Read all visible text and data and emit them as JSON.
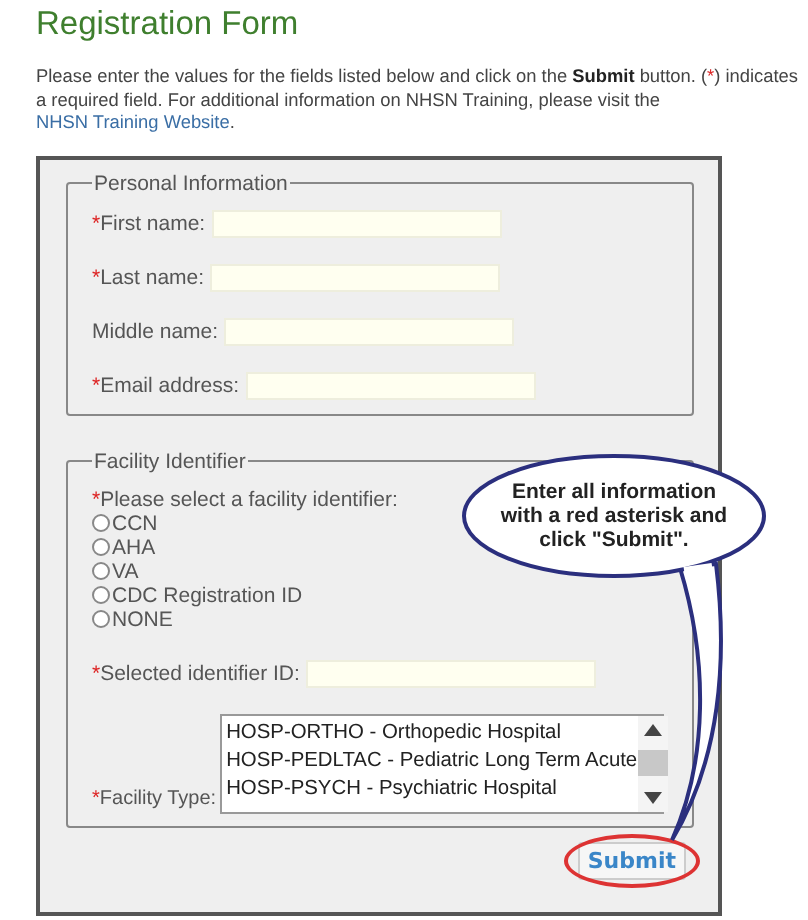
{
  "title": "Registration Form",
  "intro": {
    "before": "Please enter the values for the fields listed below and click on the **Submit** button. (",
    "asterisk": "*",
    "middle": ") indicates a required field. For additional information on NHSN Training, please visit the ",
    "link": "NHSN Training Website",
    "end": "."
  },
  "personal": {
    "legend": "Personal Information",
    "fields": [
      {
        "mark": "*",
        "label": "First name:"
      },
      {
        "mark": "*",
        "label": "Last name:"
      },
      {
        "label": "Middle name:"
      },
      {
        "mark": "*",
        "label": "Email address:"
      }
    ]
  },
  "facility": {
    "legend": "Facility Identifier",
    "prompt_mark": "*",
    "prompt": "Please select a facility identifier:",
    "options": [
      {
        "label": "CCN",
        "selected": false
      },
      {
        "label": "AHA",
        "selected": false
      },
      {
        "label": "VA",
        "selected": false
      },
      {
        "label": "CDC Registration ID",
        "selected": false
      },
      {
        "label": "NONE",
        "selected": false
      }
    ],
    "id_field": {
      "mark": "*",
      "label": "Selected identifier ID:"
    },
    "type_field": {
      "mark": "*",
      "label": "Facility Type:",
      "items": [
        "HOSP-ORTHO - Orthopedic Hospital",
        "HOSP-PEDLTAC - Pediatric Long Term Acute",
        "HOSP-PSYCH - Psychiatric Hospital"
      ]
    }
  },
  "submit": "Submit",
  "callout": "Enter all information with a red asterisk and click \"Submit\"."
}
